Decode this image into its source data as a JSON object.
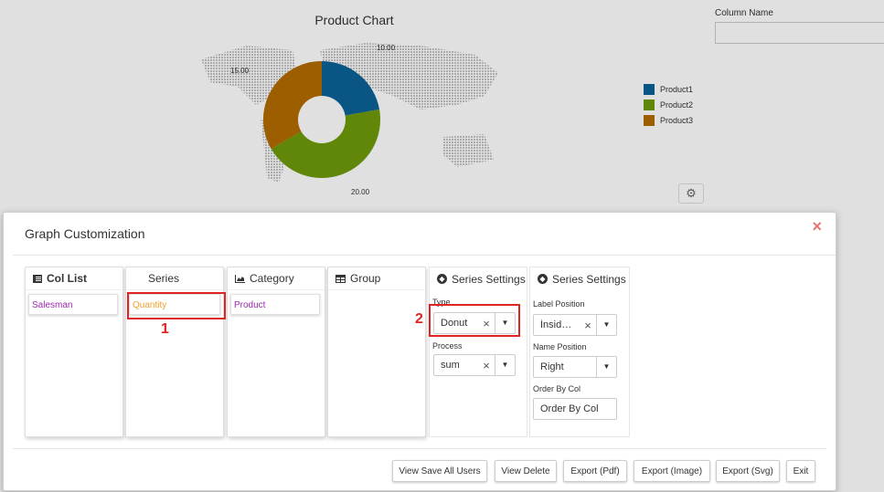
{
  "chart": {
    "title": "Product Chart",
    "data_labels": [
      "10.00",
      "15.00",
      "20.00"
    ],
    "legend": [
      {
        "name": "Product1",
        "color": "#0b6196"
      },
      {
        "name": "Product2",
        "color": "#6f9a0a"
      },
      {
        "name": "Product3",
        "color": "#b36b00"
      }
    ]
  },
  "chart_data": {
    "type": "pie",
    "title": "Product Chart",
    "series": [
      {
        "name": "Product1",
        "value": 10.0
      },
      {
        "name": "Product2",
        "value": 20.0
      },
      {
        "name": "Product3",
        "value": 15.0
      }
    ],
    "legend_position": "right"
  },
  "column_name": {
    "label": "Column Name",
    "value": ""
  },
  "modal": {
    "title": "Graph Customization",
    "close": "×",
    "panels": {
      "col_list": {
        "title": "Col List",
        "items": [
          "Salesman"
        ]
      },
      "series": {
        "title": "Series",
        "items": [
          "Quantity"
        ]
      },
      "category": {
        "title": "Category",
        "items": [
          "Product"
        ]
      },
      "group": {
        "title": "Group",
        "items": []
      }
    },
    "series_settings_1": {
      "title": "Series Settings",
      "type_label": "Type",
      "type_value": "Donut",
      "process_label": "Process",
      "process_value": "sum"
    },
    "series_settings_2": {
      "title": "Series Settings",
      "label_position_label": "Label Position",
      "label_position_value": "İnsid…",
      "name_position_label": "Name Position",
      "name_position_value": "Right",
      "order_by_label": "Order By Col",
      "order_by_value": "Order By Col"
    },
    "buttons": {
      "view_save_all_users": "View Save All Users",
      "view_delete": "View Delete",
      "export_pdf": "Export (Pdf)",
      "export_image": "Export (Image)",
      "export_svg": "Export (Svg)",
      "exit": "Exit"
    }
  },
  "annotations": {
    "one": "1",
    "two": "2",
    "color": "#e02424"
  },
  "icons": {
    "clear": "×",
    "dropdown": "▼",
    "gear": "⚙"
  }
}
